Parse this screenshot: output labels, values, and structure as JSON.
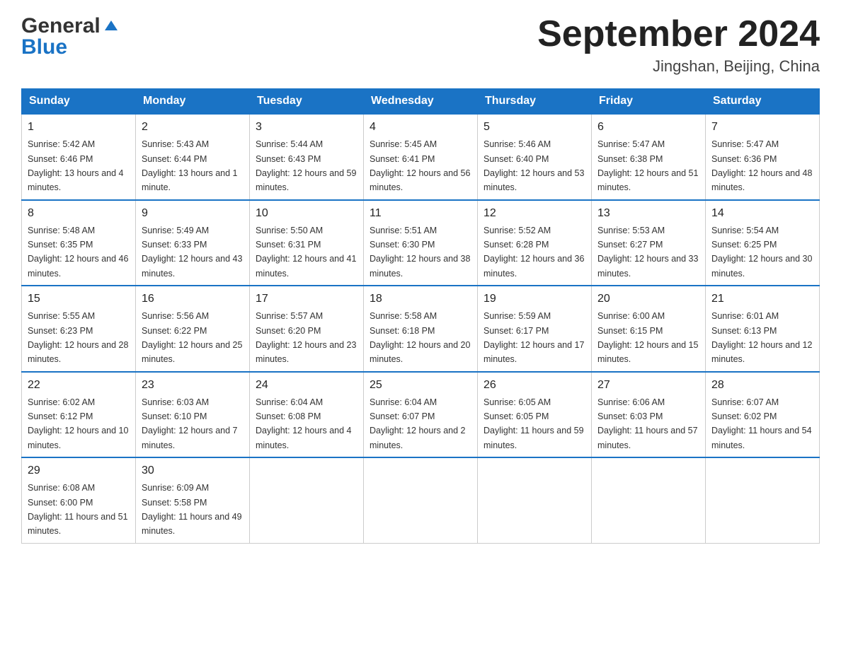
{
  "header": {
    "title": "September 2024",
    "subtitle": "Jingshan, Beijing, China",
    "logo_general": "General",
    "logo_blue": "Blue"
  },
  "days_of_week": [
    "Sunday",
    "Monday",
    "Tuesday",
    "Wednesday",
    "Thursday",
    "Friday",
    "Saturday"
  ],
  "weeks": [
    [
      {
        "day": "1",
        "sunrise": "5:42 AM",
        "sunset": "6:46 PM",
        "daylight": "13 hours and 4 minutes."
      },
      {
        "day": "2",
        "sunrise": "5:43 AM",
        "sunset": "6:44 PM",
        "daylight": "13 hours and 1 minute."
      },
      {
        "day": "3",
        "sunrise": "5:44 AM",
        "sunset": "6:43 PM",
        "daylight": "12 hours and 59 minutes."
      },
      {
        "day": "4",
        "sunrise": "5:45 AM",
        "sunset": "6:41 PM",
        "daylight": "12 hours and 56 minutes."
      },
      {
        "day": "5",
        "sunrise": "5:46 AM",
        "sunset": "6:40 PM",
        "daylight": "12 hours and 53 minutes."
      },
      {
        "day": "6",
        "sunrise": "5:47 AM",
        "sunset": "6:38 PM",
        "daylight": "12 hours and 51 minutes."
      },
      {
        "day": "7",
        "sunrise": "5:47 AM",
        "sunset": "6:36 PM",
        "daylight": "12 hours and 48 minutes."
      }
    ],
    [
      {
        "day": "8",
        "sunrise": "5:48 AM",
        "sunset": "6:35 PM",
        "daylight": "12 hours and 46 minutes."
      },
      {
        "day": "9",
        "sunrise": "5:49 AM",
        "sunset": "6:33 PM",
        "daylight": "12 hours and 43 minutes."
      },
      {
        "day": "10",
        "sunrise": "5:50 AM",
        "sunset": "6:31 PM",
        "daylight": "12 hours and 41 minutes."
      },
      {
        "day": "11",
        "sunrise": "5:51 AM",
        "sunset": "6:30 PM",
        "daylight": "12 hours and 38 minutes."
      },
      {
        "day": "12",
        "sunrise": "5:52 AM",
        "sunset": "6:28 PM",
        "daylight": "12 hours and 36 minutes."
      },
      {
        "day": "13",
        "sunrise": "5:53 AM",
        "sunset": "6:27 PM",
        "daylight": "12 hours and 33 minutes."
      },
      {
        "day": "14",
        "sunrise": "5:54 AM",
        "sunset": "6:25 PM",
        "daylight": "12 hours and 30 minutes."
      }
    ],
    [
      {
        "day": "15",
        "sunrise": "5:55 AM",
        "sunset": "6:23 PM",
        "daylight": "12 hours and 28 minutes."
      },
      {
        "day": "16",
        "sunrise": "5:56 AM",
        "sunset": "6:22 PM",
        "daylight": "12 hours and 25 minutes."
      },
      {
        "day": "17",
        "sunrise": "5:57 AM",
        "sunset": "6:20 PM",
        "daylight": "12 hours and 23 minutes."
      },
      {
        "day": "18",
        "sunrise": "5:58 AM",
        "sunset": "6:18 PM",
        "daylight": "12 hours and 20 minutes."
      },
      {
        "day": "19",
        "sunrise": "5:59 AM",
        "sunset": "6:17 PM",
        "daylight": "12 hours and 17 minutes."
      },
      {
        "day": "20",
        "sunrise": "6:00 AM",
        "sunset": "6:15 PM",
        "daylight": "12 hours and 15 minutes."
      },
      {
        "day": "21",
        "sunrise": "6:01 AM",
        "sunset": "6:13 PM",
        "daylight": "12 hours and 12 minutes."
      }
    ],
    [
      {
        "day": "22",
        "sunrise": "6:02 AM",
        "sunset": "6:12 PM",
        "daylight": "12 hours and 10 minutes."
      },
      {
        "day": "23",
        "sunrise": "6:03 AM",
        "sunset": "6:10 PM",
        "daylight": "12 hours and 7 minutes."
      },
      {
        "day": "24",
        "sunrise": "6:04 AM",
        "sunset": "6:08 PM",
        "daylight": "12 hours and 4 minutes."
      },
      {
        "day": "25",
        "sunrise": "6:04 AM",
        "sunset": "6:07 PM",
        "daylight": "12 hours and 2 minutes."
      },
      {
        "day": "26",
        "sunrise": "6:05 AM",
        "sunset": "6:05 PM",
        "daylight": "11 hours and 59 minutes."
      },
      {
        "day": "27",
        "sunrise": "6:06 AM",
        "sunset": "6:03 PM",
        "daylight": "11 hours and 57 minutes."
      },
      {
        "day": "28",
        "sunrise": "6:07 AM",
        "sunset": "6:02 PM",
        "daylight": "11 hours and 54 minutes."
      }
    ],
    [
      {
        "day": "29",
        "sunrise": "6:08 AM",
        "sunset": "6:00 PM",
        "daylight": "11 hours and 51 minutes."
      },
      {
        "day": "30",
        "sunrise": "6:09 AM",
        "sunset": "5:58 PM",
        "daylight": "11 hours and 49 minutes."
      },
      null,
      null,
      null,
      null,
      null
    ]
  ],
  "labels": {
    "sunrise": "Sunrise:",
    "sunset": "Sunset:",
    "daylight": "Daylight:"
  }
}
